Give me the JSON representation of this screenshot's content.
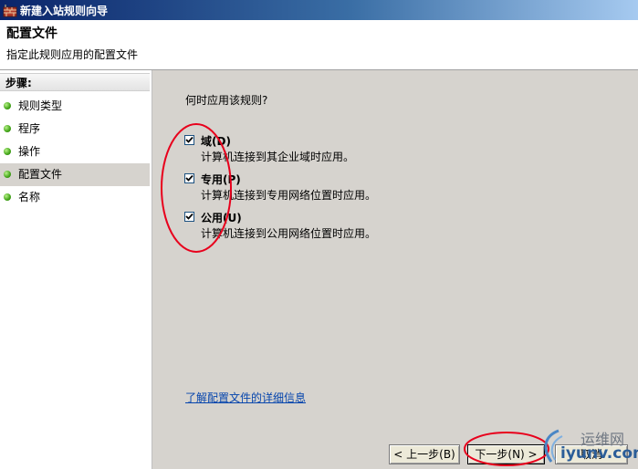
{
  "window": {
    "title": "新建入站规则向导"
  },
  "header": {
    "title": "配置文件",
    "subtitle": "指定此规则应用的配置文件"
  },
  "sidebar": {
    "heading": "步骤:",
    "items": [
      {
        "label": "规则类型",
        "active": false
      },
      {
        "label": "程序",
        "active": false
      },
      {
        "label": "操作",
        "active": false
      },
      {
        "label": "配置文件",
        "active": true
      },
      {
        "label": "名称",
        "active": false
      }
    ]
  },
  "main": {
    "question": "何时应用该规则?",
    "options": [
      {
        "label": "域(D)",
        "description": "计算机连接到其企业域时应用。",
        "checked": true
      },
      {
        "label": "专用(P)",
        "description": "计算机连接到专用网络位置时应用。",
        "checked": true
      },
      {
        "label": "公用(U)",
        "description": "计算机连接到公用网络位置时应用。",
        "checked": true
      }
    ],
    "learn_more": "了解配置文件的详细信息"
  },
  "buttons": {
    "back": "< 上一步(B)",
    "next": "下一步(N) >",
    "cancel": "取消"
  },
  "watermark": {
    "top": "运维网",
    "bottom": "iyunv.com"
  },
  "colors": {
    "annotation": "#e8001c",
    "accent": "#0a246a"
  }
}
